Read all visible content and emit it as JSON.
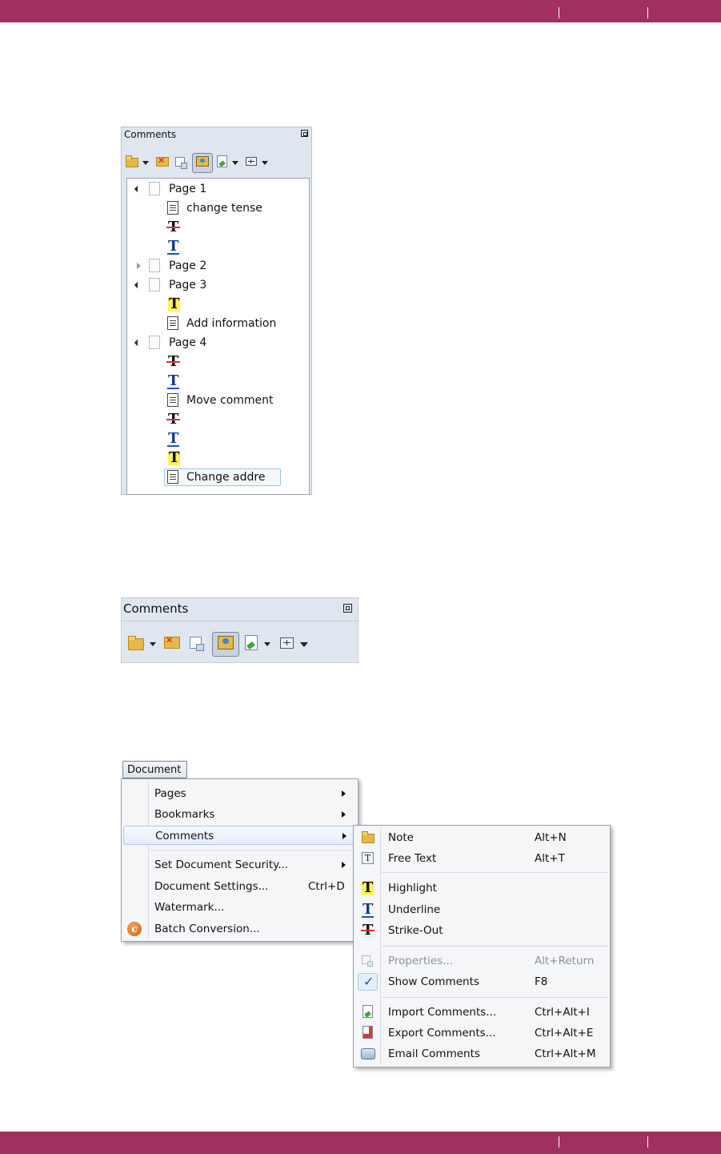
{
  "panel_small": {
    "title": "Comments",
    "tree": [
      {
        "kind": "page",
        "label": "Page 1",
        "expanded": true
      },
      {
        "kind": "note",
        "label": "change tense"
      },
      {
        "kind": "strike"
      },
      {
        "kind": "underline"
      },
      {
        "kind": "page",
        "label": "Page 2",
        "expanded": false
      },
      {
        "kind": "page",
        "label": "Page 3",
        "expanded": true
      },
      {
        "kind": "highlight"
      },
      {
        "kind": "note",
        "label": "Add information"
      },
      {
        "kind": "page",
        "label": "Page 4",
        "expanded": true
      },
      {
        "kind": "strike"
      },
      {
        "kind": "underline"
      },
      {
        "kind": "note",
        "label": "Move comment"
      },
      {
        "kind": "strike"
      },
      {
        "kind": "underline"
      },
      {
        "kind": "highlight"
      },
      {
        "kind": "note",
        "label": "Change addre",
        "selected": true
      }
    ]
  },
  "panel_large": {
    "title": "Comments"
  },
  "glyph": "T",
  "toolbar_icons": [
    "new-note-folder-icon",
    "delete-folder-icon",
    "properties-icon",
    "show-comments-icon",
    "import-comments-icon",
    "expand-icon"
  ],
  "menu_bar": {
    "document_label": "Document"
  },
  "document_menu": {
    "items": [
      {
        "label": "Pages",
        "submenu": true
      },
      {
        "label": "Bookmarks",
        "submenu": true
      },
      {
        "label": "Comments",
        "submenu": true,
        "highlighted": true
      },
      {
        "label": "Set Document Security...",
        "submenu": true
      },
      {
        "label": "Document Settings...",
        "shortcut": "Ctrl+D"
      },
      {
        "label": "Watermark..."
      },
      {
        "label": "Batch Conversion...",
        "icon": "batch-conversion-icon"
      }
    ]
  },
  "comments_submenu": {
    "items": [
      {
        "label": "Note",
        "shortcut": "Alt+N",
        "icon": "note-icon"
      },
      {
        "label": "Free Text",
        "shortcut": "Alt+T",
        "icon": "free-text-icon"
      },
      {
        "label": "Highlight",
        "icon": "highlight-icon"
      },
      {
        "label": "Underline",
        "icon": "underline-icon"
      },
      {
        "label": "Strike-Out",
        "icon": "strike-out-icon"
      },
      {
        "label": "Properties...",
        "shortcut": "Alt+Return",
        "icon": "properties-icon",
        "disabled": true
      },
      {
        "label": "Show Comments",
        "shortcut": "F8",
        "checked": true
      },
      {
        "label": "Import Comments...",
        "shortcut": "Ctrl+Alt+I",
        "icon": "import-comments-icon"
      },
      {
        "label": "Export Comments...",
        "shortcut": "Ctrl+Alt+E",
        "icon": "export-comments-icon"
      },
      {
        "label": "Email Comments",
        "shortcut": "Ctrl+Alt+M",
        "icon": "email-comments-icon"
      }
    ]
  },
  "colors": {
    "header_bar": "#a0305d",
    "panel_bg": "#dfe6ef",
    "highlight_yellow": "#fff15a",
    "strike_red": "#e23030",
    "underline_blue": "#1c51c8"
  }
}
